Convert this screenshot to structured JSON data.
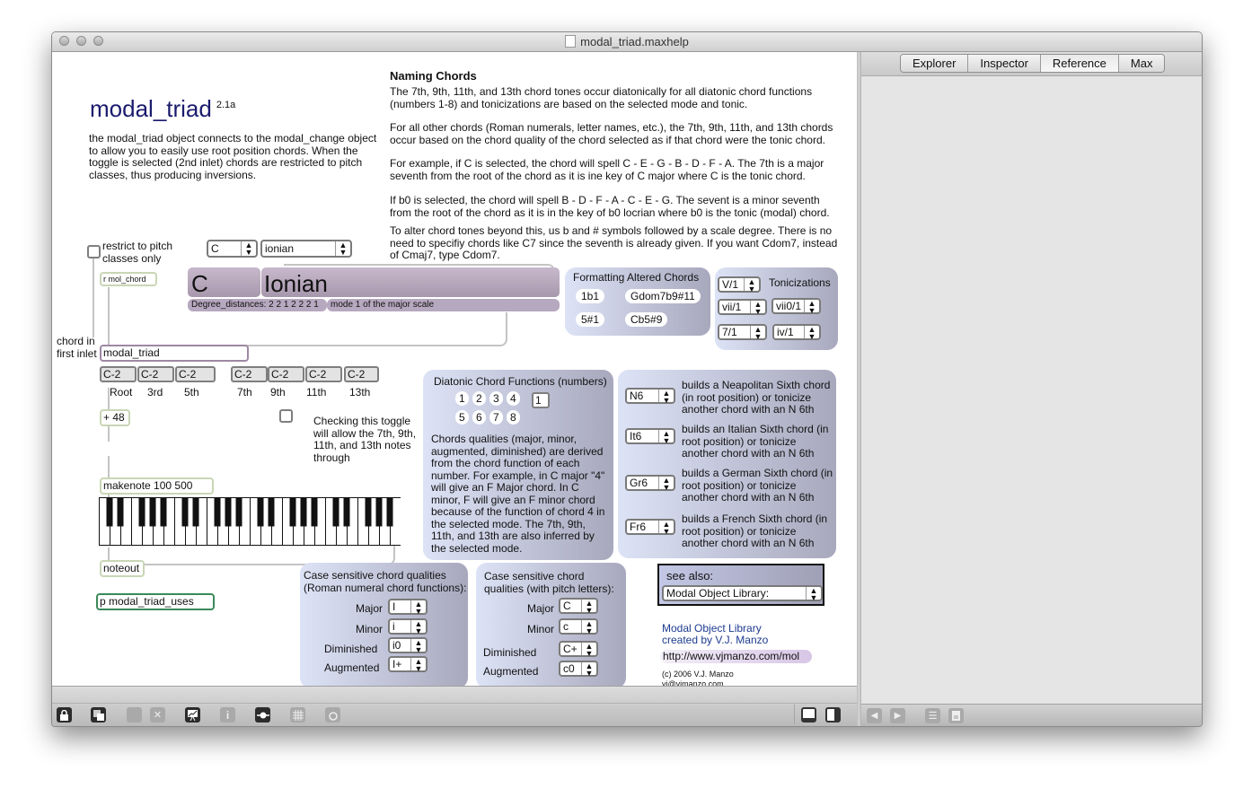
{
  "window": {
    "title": "modal_triad.maxhelp",
    "controls": [
      "close",
      "minimize",
      "zoom"
    ]
  },
  "sidepanel": {
    "tabs": [
      {
        "label": "Explorer",
        "active": false
      },
      {
        "label": "Inspector",
        "active": false
      },
      {
        "label": "Reference",
        "active": true
      },
      {
        "label": "Max",
        "active": false
      }
    ]
  },
  "header": {
    "title": "modal_triad",
    "version": "2.1a",
    "description": "the modal_triad object connects to the modal_change object to allow you to easily use root position chords. When the toggle is selected (2nd inlet) chords are restricted to pitch classes, thus producing inversions."
  },
  "naming": {
    "heading": "Naming Chords",
    "p1": "The 7th, 9th, 11th, and 13th chord tones occur diatonically for all diatonic chord functions (numbers 1-8) and tonicizations are based on the selected mode and tonic.",
    "p2": "For all other chords (Roman numerals, letter names, etc.), the 7th, 9th, 11th, and 13th chords occur based on the chord quality of the chord selected as if that chord were the tonic chord.",
    "p3": "For example, if C is selected, the chord will spell C - E - G - B - D - F - A. The 7th is a major seventh from the root of the chord as it is ine key of C major where C is the tonic chord.",
    "p4": "If b0 is selected, the chord will spell B - D - F - A - C - E - G. The sevent is a minor seventh from the root of the chord as it is in the key of b0 locrian where b0 is the tonic (modal) chord.",
    "p5": "To alter chord tones beyond this, us b and # symbols followed by a scale degree. There is no need to specifiy chords like C7 since the seventh is already given. If you want Cdom7, instead of Cmaj7, type Cdom7."
  },
  "patch": {
    "restrict_label": "restrict to pitch classes only",
    "restrict_checked": false,
    "receive_object": "r mol_chord",
    "tonic_menu": "C",
    "mode_menu": "ionian",
    "tonic_display": "C",
    "mode_display": "Ionian",
    "degree_distances": "Degree_distances: 2 2 1 2 2 2 1",
    "mode_desc": "mode 1 of the major scale",
    "chord_in_label": "chord in first inlet",
    "main_object": "modal_triad",
    "outputs": [
      {
        "value": "C-2",
        "label": "Root"
      },
      {
        "value": "C-2",
        "label": "3rd"
      },
      {
        "value": "C-2",
        "label": "5th"
      },
      {
        "value": "C-2",
        "label": "7th"
      },
      {
        "value": "C-2",
        "label": "9th"
      },
      {
        "value": "C-2",
        "label": "11th"
      },
      {
        "value": "C-2",
        "label": "13th"
      }
    ],
    "plus_object": "+ 48",
    "extensions_checked": false,
    "extensions_note": "Checking this toggle will allow the 7th, 9th, 11th, and 13th notes through",
    "makenote_object": "makenote 100 500",
    "noteout_object": "noteout",
    "subpatch_object": "p modal_triad_uses"
  },
  "altered": {
    "title": "Formatting Altered Chords",
    "messages": [
      "1b1",
      "Gdom7b9#11",
      "5#1",
      "Cb5#9"
    ]
  },
  "tonicizations": {
    "title": "Tonicizations",
    "menus": [
      "V/1",
      "vii/1",
      "vii0/1",
      "7/1",
      "iv/1"
    ]
  },
  "diatonic": {
    "title": "Diatonic Chord Functions (numbers)",
    "numbers": [
      "1",
      "2",
      "3",
      "4",
      "5",
      "6",
      "7",
      "8"
    ],
    "current": "1",
    "description": "Chords qualities (major, minor, augmented, diminished) are derived from the chord function of each number. For example, in C major \"4\" will give an F Major chord. In C minor, F will give an F minor chord because of the function of chord 4 in the selected mode. The 7th, 9th, 11th, and 13th are also inferred by the selected mode."
  },
  "sixths": [
    {
      "menu": "N6",
      "text": "builds a Neapolitan Sixth chord (in root position) or tonicize another chord with an N 6th"
    },
    {
      "menu": "It6",
      "text": "builds an Italian Sixth chord (in root position) or tonicize another chord with an N 6th"
    },
    {
      "menu": "Gr6",
      "text": "builds a German Sixth chord (in root position) or tonicize another chord with an N 6th"
    },
    {
      "menu": "Fr6",
      "text": "builds a French Sixth chord (in root position) or tonicize another chord with an N 6th"
    }
  ],
  "roman_qualities": {
    "title": "Case sensitive chord qualities (Roman numeral chord functions):",
    "rows": [
      {
        "label": "Major",
        "value": "I"
      },
      {
        "label": "Minor",
        "value": "i"
      },
      {
        "label": "Diminished",
        "value": "i0"
      },
      {
        "label": "Augmented",
        "value": "I+"
      }
    ]
  },
  "letter_qualities": {
    "title": "Case sensitive chord qualities (with pitch letters):",
    "rows": [
      {
        "label": "Major",
        "value": "C"
      },
      {
        "label": "Minor",
        "value": "c"
      },
      {
        "label": "Diminished",
        "value": "C+"
      },
      {
        "label": "Augmented",
        "value": "c0"
      }
    ]
  },
  "see_also": {
    "title": "see also:",
    "menu": "Modal Object Library:"
  },
  "credits": {
    "line1": "Modal Object Library",
    "line2": "created by V.J. Manzo",
    "url": "http://www.vjmanzo.com/mol",
    "copyright": "(c) 2006 V.J. Manzo",
    "email": "vj@vjmanzo.com"
  },
  "toolbar": {
    "icons": [
      "lock-icon",
      "new-object-icon",
      "cable-icon",
      "clear-icon",
      "presentation-icon",
      "info-icon",
      "object-hint-icon",
      "grid-icon",
      "debug-icon"
    ],
    "layout_icons": [
      "single-pane-icon",
      "split-pane-icon"
    ],
    "side_icons": [
      "back-icon",
      "forward-icon",
      "list-icon",
      "document-icon"
    ]
  },
  "colors": {
    "title_blue": "#1b1b6e",
    "link_blue": "#1d3b8f",
    "purple_bar": "#b6a8bf",
    "panel_left": "#dde3f6",
    "panel_right": "#a8a8bd",
    "green_box": "#3a8a5a"
  }
}
